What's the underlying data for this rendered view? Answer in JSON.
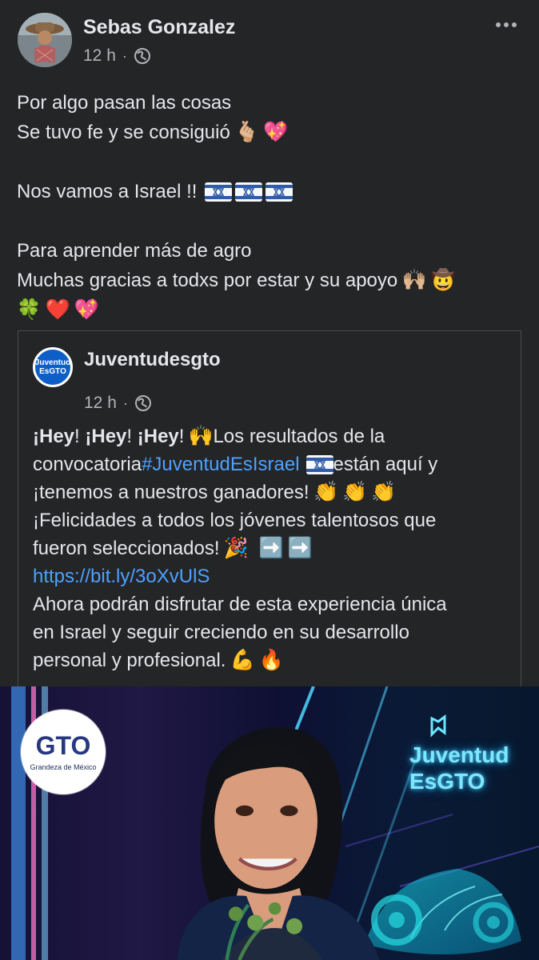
{
  "post": {
    "author": "Sebas Gonzalez",
    "time": "12 h",
    "separator": "·",
    "lines": [
      {
        "text": "Por algo pasan las cosas"
      },
      {
        "text": "Se tuvo fe y se consiguió",
        "emoji": [
          "🫰🏼",
          "💖"
        ]
      },
      {
        "text": ""
      },
      {
        "text": "Nos vamos a Israel !!"
      },
      {
        "text": ""
      },
      {
        "text": "Para aprender más de agro"
      },
      {
        "text": "Muchas gracias a todxs por estar y su apoyo",
        "emoji": [
          "🙌🏼",
          "🤠"
        ]
      },
      {
        "text": "",
        "emoji": [
          "🍀",
          "❤️",
          "💖"
        ]
      }
    ]
  },
  "shared": {
    "author": "Juventudesgto",
    "time": "12 h",
    "separator": "·",
    "avatar_text_1": "Juventud",
    "avatar_text_2": "EsGTO",
    "hey_1": "¡Hey",
    "hey_2": "¡Hey",
    "hey_3": "¡Hey",
    "exclamation": "!",
    "line1_rest": " Los resultados de la",
    "line2_start": "convocatoria ",
    "hashtag": "#JuventudEsIsrael",
    "line2_end": " están aquí y",
    "line3": "¡tenemos a nuestros ganadores!",
    "line4": "¡Felicidades a todos los jóvenes talentosos que",
    "line5": "fueron seleccionados!",
    "link": "https://bit.ly/3oXvUlS",
    "line7": "Ahora podrán disfrutar de esta experiencia única",
    "line8": "en Israel y seguir creciendo en su desarrollo",
    "line9": "personal y profesional."
  },
  "poster": {
    "logo_main": "GTO",
    "logo_tagline": "Grandeza de México",
    "brand_line_1": "Juventud",
    "brand_line_2": "EsGTO"
  },
  "icons": {
    "avatar": "avatar",
    "privacy": "globe-icon",
    "more": "more-icon",
    "flag": "israel-flag-icon"
  },
  "colors": {
    "background": "#242526",
    "text": "#e4e6eb",
    "secondary_text": "#b0b3b8",
    "link": "#4ea1ff"
  }
}
